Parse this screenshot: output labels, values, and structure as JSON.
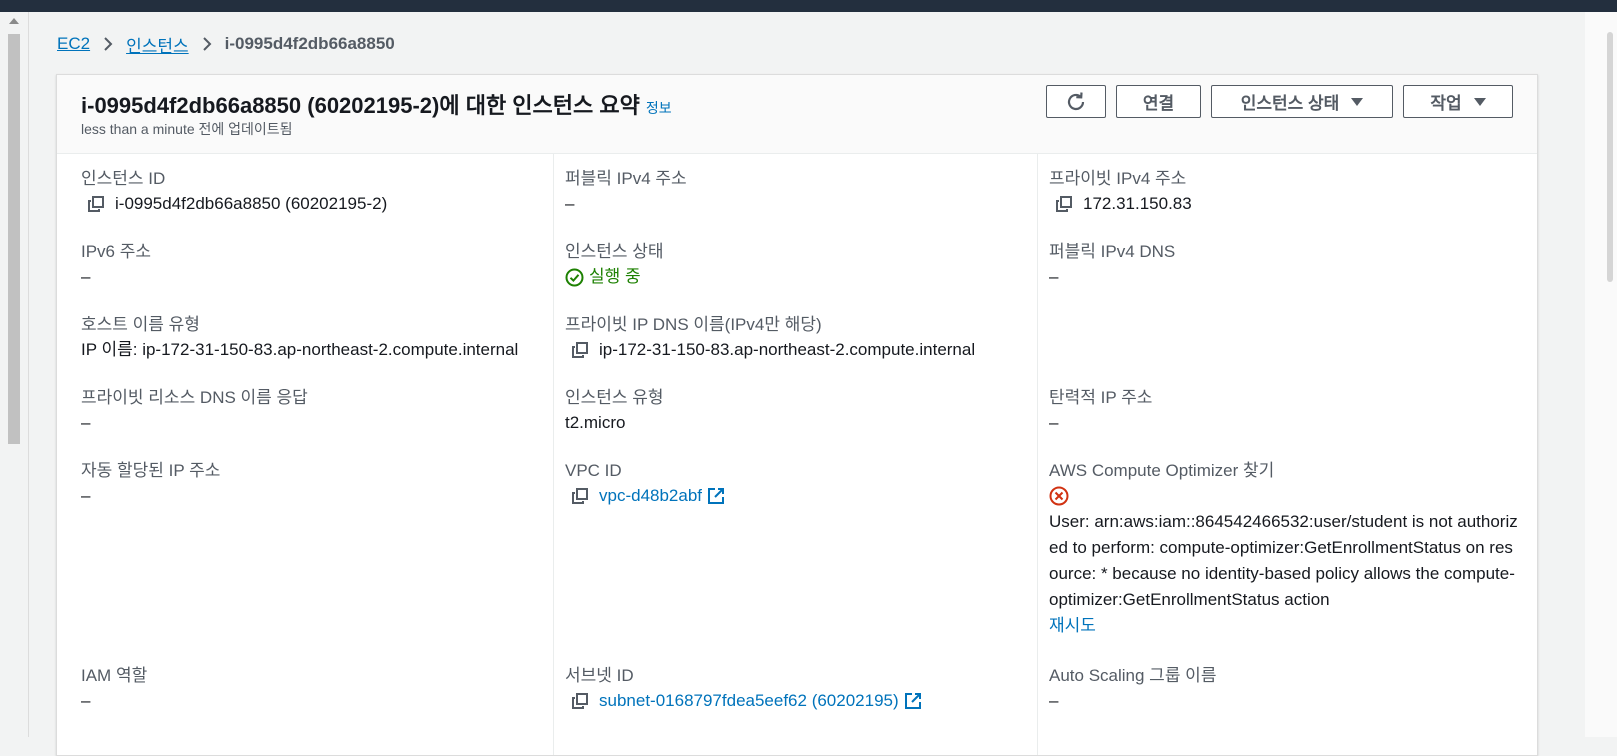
{
  "breadcrumb": {
    "root": "EC2",
    "section": "인스턴스",
    "current": "i-0995d4f2db66a8850"
  },
  "header": {
    "title": "i-0995d4f2db66a8850 (60202195-2)에 대한 인스턴스 요약",
    "info_link": "정보",
    "updated": "less than a minute 전에 업데이트됨",
    "connect_label": "연결",
    "instance_state_label": "인스턴스 상태",
    "actions_label": "작업"
  },
  "fields": {
    "instance_id": {
      "label": "인스턴스 ID",
      "value": "i-0995d4f2db66a8850 (60202195-2)"
    },
    "public_ipv4": {
      "label": "퍼블릭 IPv4 주소",
      "value": "–"
    },
    "private_ipv4": {
      "label": "프라이빗 IPv4 주소",
      "value": "172.31.150.83"
    },
    "ipv6": {
      "label": "IPv6 주소",
      "value": "–"
    },
    "instance_state": {
      "label": "인스턴스 상태",
      "value": "실행 중"
    },
    "public_dns": {
      "label": "퍼블릭 IPv4 DNS",
      "value": "–"
    },
    "hostname_type": {
      "label": "호스트 이름 유형",
      "value": "IP 이름: ip-172-31-150-83.ap-northeast-2.compute.internal"
    },
    "private_dns": {
      "label": "프라이빗 IP DNS 이름(IPv4만 해당)",
      "value": "ip-172-31-150-83.ap-northeast-2.compute.internal"
    },
    "private_resource_dns": {
      "label": "프라이빗 리소스 DNS 이름 응답",
      "value": "–"
    },
    "instance_type": {
      "label": "인스턴스 유형",
      "value": "t2.micro"
    },
    "elastic_ip": {
      "label": "탄력적 IP 주소",
      "value": "–"
    },
    "auto_ip": {
      "label": "자동 할당된 IP 주소",
      "value": "–"
    },
    "vpc_id": {
      "label": "VPC ID",
      "value": "vpc-d48b2abf"
    },
    "compute_optimizer": {
      "label": "AWS Compute Optimizer 찾기",
      "error": "User: arn:aws:iam::864542466532:user/student is not authorized to perform: compute-optimizer:GetEnrollmentStatus on resource: * because no identity-based policy allows the compute-optimizer:GetEnrollmentStatus action",
      "retry": "재시도"
    },
    "iam_role": {
      "label": "IAM 역할",
      "value": "–"
    },
    "subnet_id": {
      "label": "서브넷 ID",
      "value": "subnet-0168797fdea5eef62 (60202195)"
    },
    "asg_name": {
      "label": "Auto Scaling 그룹 이름",
      "value": "–"
    }
  },
  "icons": {
    "copy": "copy-icon",
    "external": "external-link-icon",
    "refresh": "refresh-icon",
    "success": "success-check-icon",
    "error": "error-x-icon"
  },
  "colors": {
    "link": "#0073bb",
    "success": "#1d8102",
    "error": "#d13212",
    "topbar": "#232f3e"
  }
}
